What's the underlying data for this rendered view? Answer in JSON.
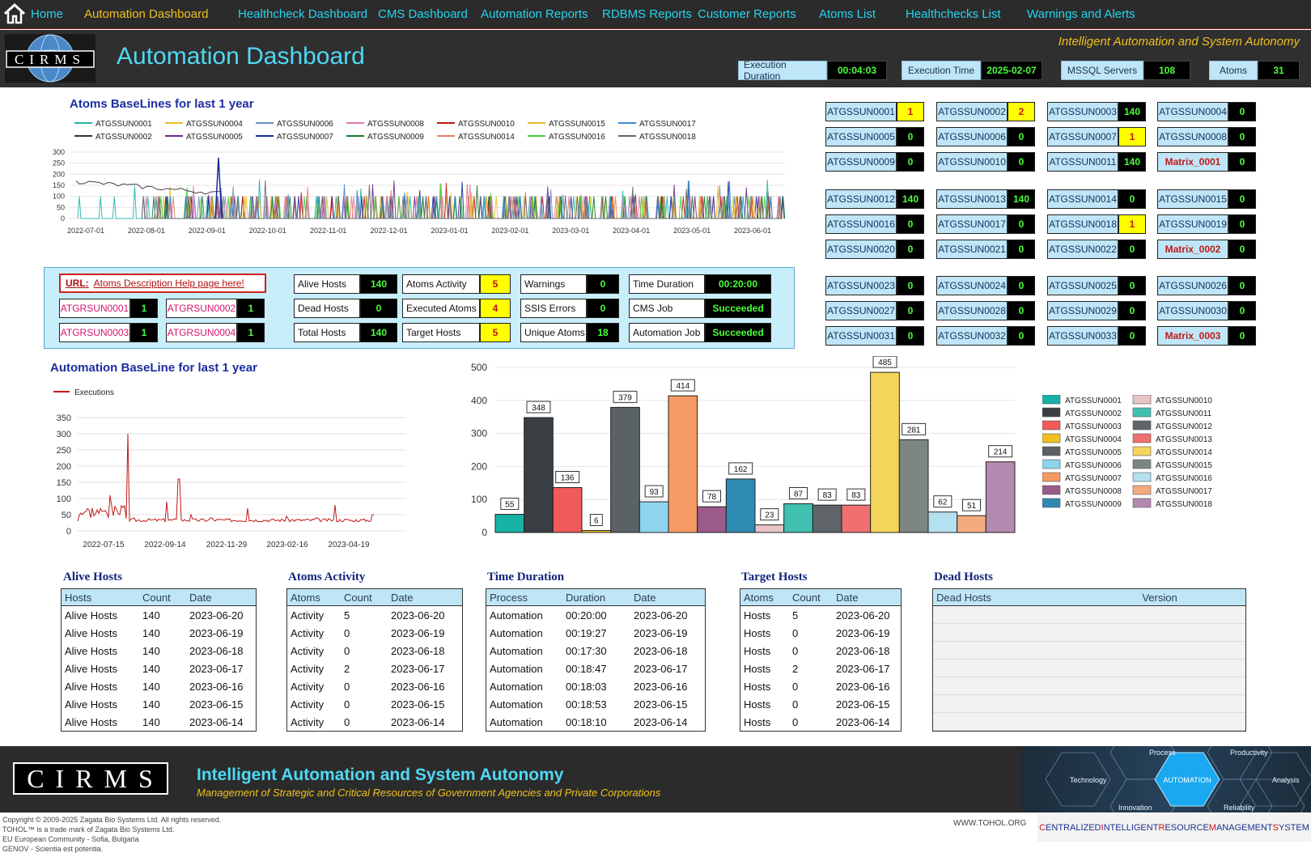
{
  "nav": {
    "home_label": "Home",
    "items": [
      {
        "label": "Automation Dashboard",
        "active": true
      },
      {
        "label": "Healthcheck Dashboard"
      },
      {
        "label": "CMS Dashboard"
      },
      {
        "label": "Automation Reports"
      },
      {
        "label": "RDBMS Reports"
      },
      {
        "label": "Customer Reports"
      },
      {
        "label": "Atoms List"
      },
      {
        "label": "Healthchecks List"
      },
      {
        "label": "Warnings and Alerts"
      }
    ]
  },
  "header": {
    "logo_text": "CIRMS",
    "title": "Automation Dashboard",
    "tagline": "Intelligent Automation and System Autonomy",
    "stats": [
      {
        "label": "Execution Duration",
        "value": "00:04:03"
      },
      {
        "label": "Execution Time",
        "value": "2025-02-07"
      },
      {
        "label": "MSSQL Servers",
        "value": "108"
      },
      {
        "label": "Atoms",
        "value": "31"
      }
    ]
  },
  "baselines": {
    "title": "Atoms BaseLines for last 1 year",
    "legend": [
      {
        "name": "ATGSSUN0001",
        "color": "#1fb5a8"
      },
      {
        "name": "ATGSSUN0002",
        "color": "#333333"
      },
      {
        "name": "ATGSSUN0004",
        "color": "#e8c02a"
      },
      {
        "name": "ATGSSUN0005",
        "color": "#6a2a8a"
      },
      {
        "name": "ATGSSUN0006",
        "color": "#6a8cc0"
      },
      {
        "name": "ATGSSUN0007",
        "color": "#1a2aa0"
      },
      {
        "name": "ATGSSUN0008",
        "color": "#e078b0"
      },
      {
        "name": "ATGSSUN0009",
        "color": "#1a7a2a"
      },
      {
        "name": "ATGSSUN0010",
        "color": "#c01818"
      },
      {
        "name": "ATGSSUN0014",
        "color": "#e87a6a"
      },
      {
        "name": "ATGSSUN0015",
        "color": "#f0b830"
      },
      {
        "name": "ATGSSUN0016",
        "color": "#40d040"
      },
      {
        "name": "ATGSSUN0017",
        "color": "#3a8ad0"
      },
      {
        "name": "ATGSSUN0018",
        "color": "#666666"
      }
    ],
    "yticks": [
      "300",
      "250",
      "200",
      "150",
      "100",
      "50",
      "0"
    ],
    "xticks": [
      "2022-07-01",
      "2022-08-01",
      "2022-09-01",
      "2022-10-01",
      "2022-11-01",
      "2022-12-01",
      "2023-01-01",
      "2023-02-01",
      "2023-03-01",
      "2023-04-01",
      "2023-05-01",
      "2023-06-01"
    ]
  },
  "atom_groups": [
    [
      {
        "name": "ATGSSUN0001",
        "value": "1",
        "warn": true
      },
      {
        "name": "ATGSSUN0002",
        "value": "2",
        "warn": true
      },
      {
        "name": "ATGSSUN0003",
        "value": "140"
      },
      {
        "name": "ATGSSUN0004",
        "value": "0"
      },
      {
        "name": "ATGSSUN0005",
        "value": "0"
      },
      {
        "name": "ATGSSUN0006",
        "value": "0"
      },
      {
        "name": "ATGSSUN0007",
        "value": "1",
        "warn": true
      },
      {
        "name": "ATGSSUN0008",
        "value": "0"
      },
      {
        "name": "ATGSSUN0009",
        "value": "0"
      },
      {
        "name": "ATGSSUN0010",
        "value": "0"
      },
      {
        "name": "ATGSSUN0011",
        "value": "140"
      },
      {
        "name": "Matrix_0001",
        "value": "0",
        "matrix": true
      }
    ],
    [
      {
        "name": "ATGSSUN0012",
        "value": "140"
      },
      {
        "name": "ATGSSUN0013",
        "value": "140"
      },
      {
        "name": "ATGSSUN0014",
        "value": "0"
      },
      {
        "name": "ATGSSUN0015",
        "value": "0"
      },
      {
        "name": "ATGSSUN0016",
        "value": "0"
      },
      {
        "name": "ATGSSUN0017",
        "value": "0"
      },
      {
        "name": "ATGSSUN0018",
        "value": "1",
        "warn": true
      },
      {
        "name": "ATGSSUN0019",
        "value": "0"
      },
      {
        "name": "ATGSSUN0020",
        "value": "0"
      },
      {
        "name": "ATGSSUN0021",
        "value": "0"
      },
      {
        "name": "ATGSSUN0022",
        "value": "0"
      },
      {
        "name": "Matrix_0002",
        "value": "0",
        "matrix": true
      }
    ],
    [
      {
        "name": "ATGSSUN0023",
        "value": "0"
      },
      {
        "name": "ATGSSUN0024",
        "value": "0"
      },
      {
        "name": "ATGSSUN0025",
        "value": "0"
      },
      {
        "name": "ATGSSUN0026",
        "value": "0"
      },
      {
        "name": "ATGSSUN0027",
        "value": "0"
      },
      {
        "name": "ATGSSUN0028",
        "value": "0"
      },
      {
        "name": "ATGSSUN0029",
        "value": "0"
      },
      {
        "name": "ATGSSUN0030",
        "value": "0"
      },
      {
        "name": "ATGSSUN0031",
        "value": "0"
      },
      {
        "name": "ATGSSUN0032",
        "value": "0"
      },
      {
        "name": "ATGSSUN0033",
        "value": "0"
      },
      {
        "name": "Matrix_0003",
        "value": "0",
        "matrix": true
      }
    ]
  ],
  "info_panel": {
    "url_prefix": "URL:",
    "url_label": "Atoms Description Help page here!",
    "atgr": [
      {
        "name": "ATGRSUN0001",
        "value": "1"
      },
      {
        "name": "ATGRSUN0002",
        "value": "1"
      },
      {
        "name": "ATGRSUN0003",
        "value": "1"
      },
      {
        "name": "ATGRSUN0004",
        "value": "1"
      }
    ],
    "columns": [
      [
        {
          "label": "Alive Hosts",
          "value": "140"
        },
        {
          "label": "Dead Hosts",
          "value": "0"
        },
        {
          "label": "Total Hosts",
          "value": "140"
        }
      ],
      [
        {
          "label": "Atoms Activity",
          "value": "5",
          "warn": true
        },
        {
          "label": "Executed Atoms",
          "value": "4",
          "warn": true
        },
        {
          "label": "Target Hosts",
          "value": "5",
          "warn": true
        }
      ],
      [
        {
          "label": "Warnings",
          "value": "0"
        },
        {
          "label": "SSIS Errors",
          "value": "0"
        },
        {
          "label": "Unique Atoms",
          "value": "18"
        }
      ],
      [
        {
          "label": "Time Duration",
          "value": "00:20:00"
        },
        {
          "label": "CMS Job",
          "value": "Succeeded"
        },
        {
          "label": "Automation Job",
          "value": "Succeeded"
        }
      ]
    ]
  },
  "automation_baseline": {
    "title": "Automation BaseLine for last 1 year",
    "legend_label": "Executions",
    "line_color": "#c01818",
    "yticks": [
      "350",
      "300",
      "250",
      "200",
      "150",
      "100",
      "50",
      "0"
    ],
    "xticks": [
      "2022-07-15",
      "2022-09-14",
      "2022-11-29",
      "2023-02-16",
      "2023-04-19"
    ]
  },
  "chart_data": {
    "type": "bar",
    "categories": [
      "ATGSSUN0001",
      "ATGSSUN0002",
      "ATGSSUN0003",
      "ATGSSUN0004",
      "ATGSSUN0005",
      "ATGSSUN0006",
      "ATGSSUN0007",
      "ATGSSUN0008",
      "ATGSSUN0009",
      "ATGSSUN0010",
      "ATGSSUN0011",
      "ATGSSUN0012",
      "ATGSSUN0013",
      "ATGSSUN0014",
      "ATGSSUN0015",
      "ATGSSUN0016",
      "ATGSSUN0017",
      "ATGSSUN0018"
    ],
    "values": [
      55,
      348,
      136,
      6,
      379,
      93,
      414,
      78,
      162,
      23,
      87,
      83,
      83,
      485,
      281,
      62,
      51,
      214
    ],
    "colors": [
      "#17b2a6",
      "#3a3f44",
      "#f05a5a",
      "#f0c020",
      "#5a6265",
      "#8ed4ee",
      "#f59a62",
      "#9a5a8a",
      "#2e8ab2",
      "#e6c4c8",
      "#40c0b0",
      "#5e6468",
      "#f07070",
      "#f5d45a",
      "#7e8684",
      "#b4e0f0",
      "#f5aa80",
      "#b48ab0"
    ],
    "yticks": [
      "500",
      "400",
      "300",
      "200",
      "100",
      "0"
    ],
    "ylim": [
      0,
      500
    ],
    "legend": "right"
  },
  "tables": {
    "alive_hosts": {
      "title": "Alive Hosts",
      "headers": [
        "Hosts",
        "Count",
        "Date"
      ],
      "rows": [
        [
          "Alive Hosts",
          "140",
          "2023-06-20"
        ],
        [
          "Alive Hosts",
          "140",
          "2023-06-19"
        ],
        [
          "Alive Hosts",
          "140",
          "2023-06-18"
        ],
        [
          "Alive Hosts",
          "140",
          "2023-06-17"
        ],
        [
          "Alive Hosts",
          "140",
          "2023-06-16"
        ],
        [
          "Alive Hosts",
          "140",
          "2023-06-15"
        ],
        [
          "Alive Hosts",
          "140",
          "2023-06-14"
        ]
      ]
    },
    "atoms_activity": {
      "title": "Atoms Activity",
      "headers": [
        "Atoms",
        "Count",
        "Date"
      ],
      "rows": [
        [
          "Activity",
          "5",
          "2023-06-20"
        ],
        [
          "Activity",
          "0",
          "2023-06-19"
        ],
        [
          "Activity",
          "0",
          "2023-06-18"
        ],
        [
          "Activity",
          "2",
          "2023-06-17"
        ],
        [
          "Activity",
          "0",
          "2023-06-16"
        ],
        [
          "Activity",
          "0",
          "2023-06-15"
        ],
        [
          "Activity",
          "0",
          "2023-06-14"
        ]
      ]
    },
    "time_duration": {
      "title": "Time Duration",
      "headers": [
        "Process",
        "Duration",
        "Date"
      ],
      "rows": [
        [
          "Automation",
          "00:20:00",
          "2023-06-20"
        ],
        [
          "Automation",
          "00:19:27",
          "2023-06-19"
        ],
        [
          "Automation",
          "00:17:30",
          "2023-06-18"
        ],
        [
          "Automation",
          "00:18:47",
          "2023-06-17"
        ],
        [
          "Automation",
          "00:18:03",
          "2023-06-16"
        ],
        [
          "Automation",
          "00:18:53",
          "2023-06-15"
        ],
        [
          "Automation",
          "00:18:10",
          "2023-06-14"
        ]
      ]
    },
    "target_hosts": {
      "title": "Target Hosts",
      "headers": [
        "Atoms",
        "Count",
        "Date"
      ],
      "rows": [
        [
          "Hosts",
          "5",
          "2023-06-20"
        ],
        [
          "Hosts",
          "0",
          "2023-06-19"
        ],
        [
          "Hosts",
          "0",
          "2023-06-18"
        ],
        [
          "Hosts",
          "2",
          "2023-06-17"
        ],
        [
          "Hosts",
          "0",
          "2023-06-16"
        ],
        [
          "Hosts",
          "0",
          "2023-06-15"
        ],
        [
          "Hosts",
          "0",
          "2023-06-14"
        ]
      ]
    },
    "dead_hosts": {
      "title": "Dead Hosts",
      "headers": [
        "Dead Hosts",
        "Version"
      ],
      "rows": []
    }
  },
  "footer": {
    "logo_text": "CIRMS",
    "title": "Intelligent Automation and System Autonomy",
    "subtitle": "Management of Strategic and Critical Resources of Government Agencies and Private Corporations",
    "graphic_labels": [
      "Process",
      "Productivity",
      "Technology",
      "AUTOMATION",
      "Analysis",
      "Innovation",
      "Reliability"
    ],
    "copyright": "Copyright © 2009-2025 Zagata Bio Systems Ltd. All rights reserved.",
    "trademark": "TOHOL™ is a trade mark of Zagata Bio Systems Ltd.",
    "location": "EU European Community - Sofia, Bulgaria",
    "motto": "GENOV - Scientia est potentia.",
    "site": "WWW.TOHOL.ORG",
    "system_name": "CENTRALIZED INTELLIGENT RESOURCE MANAGEMENT SYSTEM"
  }
}
